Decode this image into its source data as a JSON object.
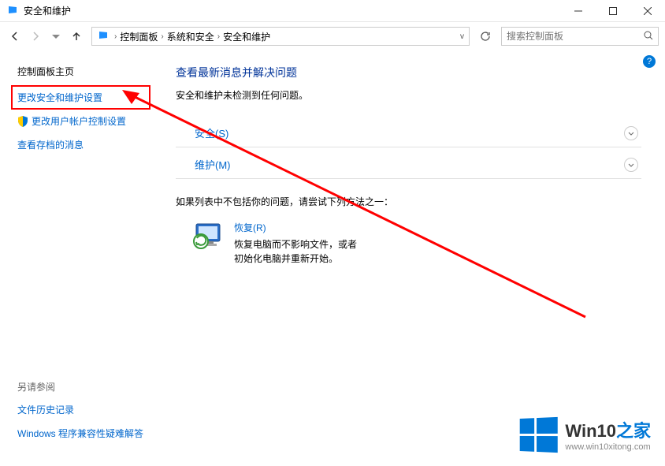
{
  "window": {
    "title": "安全和维护"
  },
  "breadcrumb": {
    "items": [
      "控制面板",
      "系统和安全",
      "安全和维护"
    ]
  },
  "search": {
    "placeholder": "搜索控制面板"
  },
  "sidebar": {
    "home": "控制面板主页",
    "link1": "更改安全和维护设置",
    "link2": "更改用户帐户控制设置",
    "link3": "查看存档的消息"
  },
  "seealso": {
    "header": "另请参阅",
    "link1": "文件历史记录",
    "link2": "Windows 程序兼容性疑难解答"
  },
  "main": {
    "heading": "查看最新消息并解决问题",
    "status": "安全和维护未检测到任何问题。",
    "sec_label": "安全(S)",
    "maint_label": "维护(M)",
    "hint": "如果列表中不包括你的问题，请尝试下列方法之一：",
    "recovery_title": "恢复(R)",
    "recovery_desc": "恢复电脑而不影响文件，或者初始化电脑并重新开始。"
  },
  "watermark": {
    "text_a": "Win10",
    "text_b": "之家",
    "url": "www.win10xitong.com"
  }
}
